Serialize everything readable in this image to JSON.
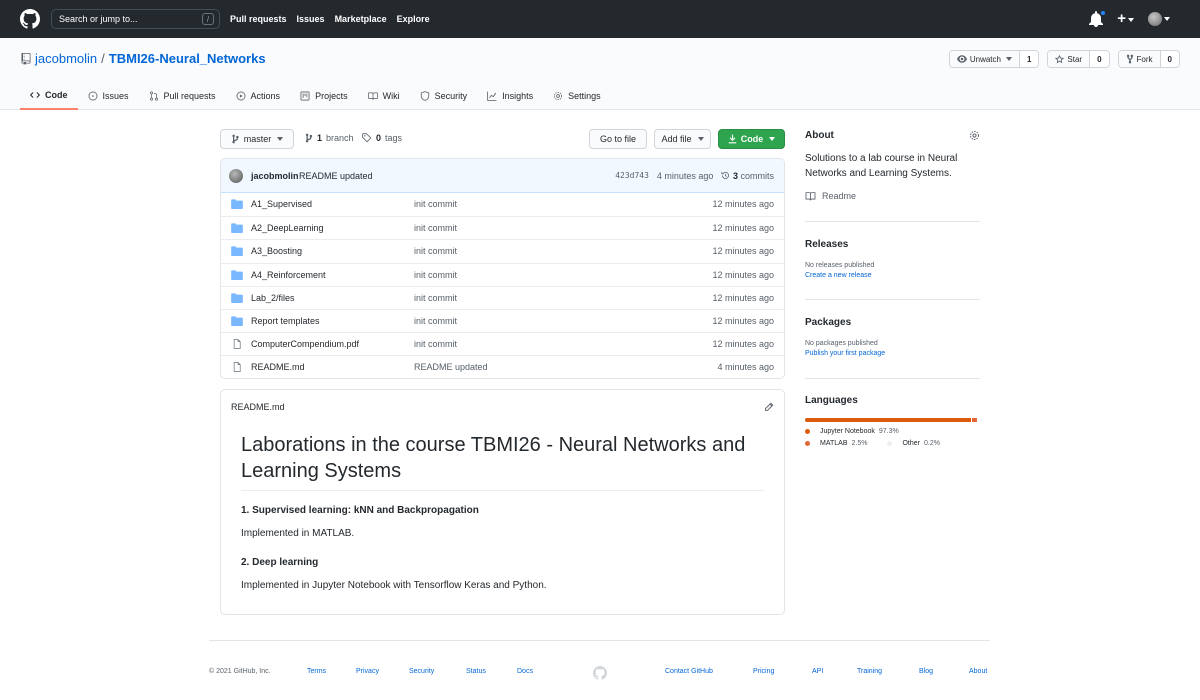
{
  "header": {
    "search_placeholder": "Search or jump to...",
    "slash_key": "/",
    "nav": [
      "Pull requests",
      "Issues",
      "Marketplace",
      "Explore"
    ],
    "plus": "+"
  },
  "repo": {
    "owner": "jacobmolin",
    "separator": "/",
    "name": "TBMI26-Neural_Networks",
    "watch_label": "Unwatch",
    "watch_count": "1",
    "star_label": "Star",
    "star_count": "0",
    "fork_label": "Fork",
    "fork_count": "0",
    "tabs": [
      "Code",
      "Issues",
      "Pull requests",
      "Actions",
      "Projects",
      "Wiki",
      "Security",
      "Insights",
      "Settings"
    ]
  },
  "toolbar": {
    "branch": "master",
    "branch_count": "1",
    "branch_word": "branch",
    "tag_count": "0",
    "tag_word": "tags",
    "go_to_file": "Go to file",
    "add_file": "Add file",
    "code": "Code"
  },
  "commit": {
    "user": "jacobmolin",
    "message": "README updated",
    "sha": "423d743",
    "age": "4 minutes ago",
    "count": "3",
    "count_word": "commits"
  },
  "files": [
    {
      "name": "A1_Supervised",
      "type": "dir",
      "message": "init commit",
      "age": "12 minutes ago"
    },
    {
      "name": "A2_DeepLearning",
      "type": "dir",
      "message": "init commit",
      "age": "12 minutes ago"
    },
    {
      "name": "A3_Boosting",
      "type": "dir",
      "message": "init commit",
      "age": "12 minutes ago"
    },
    {
      "name": "A4_Reinforcement",
      "type": "dir",
      "message": "init commit",
      "age": "12 minutes ago"
    },
    {
      "name": "Lab_2/files",
      "type": "dir",
      "message": "init commit",
      "age": "12 minutes ago"
    },
    {
      "name": "Report templates",
      "type": "dir",
      "message": "init commit",
      "age": "12 minutes ago"
    },
    {
      "name": "ComputerCompendium.pdf",
      "type": "file",
      "message": "init commit",
      "age": "12 minutes ago"
    },
    {
      "name": "README.md",
      "type": "file",
      "message": "README updated",
      "age": "4 minutes ago"
    }
  ],
  "readme": {
    "filename": "README.md",
    "h1": "Laborations in the course TBMI26 - Neural Networks and Learning Systems",
    "s1_title": "1. Supervised learning: kNN and Backpropagation",
    "s1_text": "Implemented in MATLAB.",
    "s2_title": "2. Deep learning",
    "s2_text": "Implemented in Jupyter Notebook with Tensorflow Keras and Python."
  },
  "about": {
    "title": "About",
    "description": "Solutions to a lab course in Neural Networks and Learning Systems.",
    "readme_link": "Readme"
  },
  "releases": {
    "title": "Releases",
    "empty": "No releases published",
    "link": "Create a new release"
  },
  "packages": {
    "title": "Packages",
    "empty": "No packages published",
    "link": "Publish your first package"
  },
  "languages": {
    "title": "Languages",
    "items": [
      {
        "name": "Jupyter Notebook",
        "percent": "97.3%",
        "value": 97.3,
        "color": "#DA5B0B"
      },
      {
        "name": "MATLAB",
        "percent": "2.5%",
        "value": 2.5,
        "color": "#e16737"
      },
      {
        "name": "Other",
        "percent": "0.2%",
        "value": 0.2,
        "color": "#ededed"
      }
    ]
  },
  "footer": {
    "copyright": "© 2021 GitHub, Inc.",
    "left_links": [
      "Terms",
      "Privacy",
      "Security",
      "Status",
      "Docs"
    ],
    "right_links": [
      "Contact GitHub",
      "Pricing",
      "API",
      "Training",
      "Blog",
      "About"
    ]
  },
  "colors": {
    "header_bg": "#24292e",
    "link": "#0366d6",
    "green_button": "#2ea44f",
    "active_tab_underline": "#f9826c",
    "folder_icon": "#79b8ff"
  }
}
